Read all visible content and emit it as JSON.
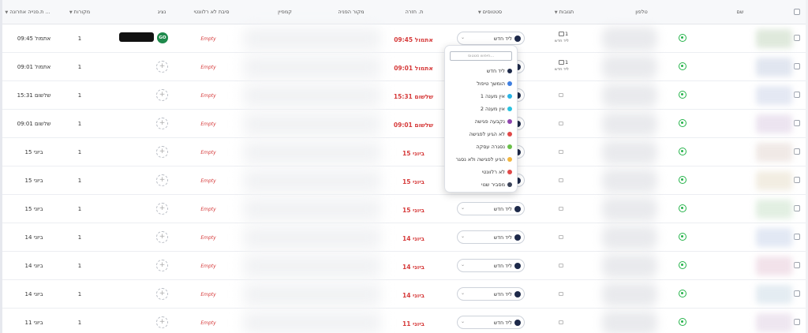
{
  "colors": {
    "accent_red": "#d63b3b",
    "whatsapp_green": "#25b34a",
    "status_new": "#1e2a4a"
  },
  "header": {
    "name": "שם",
    "phone": "טלפון",
    "messages": "תגובות",
    "status": "סטטוסים",
    "return_date": "ת. חזרה",
    "referrer": "מקור הפניה",
    "campaign": "קמפיין",
    "not_relevant_reason": "סיבת לא רלוונטי",
    "agent": "נציג",
    "sources": "מקורות",
    "last_created": "ת.פנייה אחרונה ..."
  },
  "rows": [
    {
      "msg_count": "1",
      "msg_sub": "ליד חדש",
      "status": "ליד חדש",
      "return_date": "אתמול 09:45",
      "reason": "Empty",
      "agent": "GO",
      "sources": "1",
      "created": "אתמול 09:45",
      "name_color": "#dfe9dc"
    },
    {
      "msg_count": "1",
      "msg_sub": "ליד חדש",
      "status": "ליד חדש",
      "return_date": "אתמול 09:01",
      "reason": "Empty",
      "agent": "",
      "sources": "1",
      "created": "אתמול 09:01",
      "name_color": "#e1e6f0"
    },
    {
      "msg_count": "",
      "msg_sub": "",
      "status": "ליד חדש",
      "return_date": "שלשום 15:31",
      "reason": "Empty",
      "agent": "",
      "sources": "1",
      "created": "שלשום 15:31",
      "name_color": "#e4e8f3"
    },
    {
      "msg_count": "",
      "msg_sub": "",
      "status": "ליד חדש",
      "return_date": "שלשום 09:01",
      "reason": "Empty",
      "agent": "",
      "sources": "1",
      "created": "שלשום 09:01",
      "name_color": "#ece4f0"
    },
    {
      "msg_count": "",
      "msg_sub": "",
      "status": "ליד חדש",
      "return_date": "15 ביוני",
      "reason": "Empty",
      "agent": "",
      "sources": "1",
      "created": "15 ביוני",
      "name_color": "#f0e9e6"
    },
    {
      "msg_count": "",
      "msg_sub": "",
      "status": "ליד חדש",
      "return_date": "15 ביוני",
      "reason": "Empty",
      "agent": "",
      "sources": "1",
      "created": "15 ביוני",
      "name_color": "#f2ede2"
    },
    {
      "msg_count": "",
      "msg_sub": "",
      "status": "ליד חדש",
      "return_date": "15 ביוני",
      "reason": "Empty",
      "agent": "",
      "sources": "1",
      "created": "15 ביוני",
      "name_color": "#e2efe2"
    },
    {
      "msg_count": "",
      "msg_sub": "",
      "status": "ליד חדש",
      "return_date": "14 ביוני",
      "reason": "Empty",
      "agent": "",
      "sources": "1",
      "created": "14 ביוני",
      "name_color": "#e2e8f4"
    },
    {
      "msg_count": "",
      "msg_sub": "",
      "status": "ליד חדש",
      "return_date": "14 ביוני",
      "reason": "Empty",
      "agent": "",
      "sources": "1",
      "created": "14 ביוני",
      "name_color": "#f2e2ea"
    },
    {
      "msg_count": "",
      "msg_sub": "",
      "status": "ליד חדש",
      "return_date": "14 ביוני",
      "reason": "Empty",
      "agent": "",
      "sources": "1",
      "created": "14 ביוני",
      "name_color": "#e4ecf2"
    },
    {
      "msg_count": "",
      "msg_sub": "",
      "status": "ליד חדש",
      "return_date": "11 ביוני",
      "reason": "Empty",
      "agent": "",
      "sources": "1",
      "created": "11 ביוני",
      "name_color": "#eee6f0"
    }
  ],
  "dropdown": {
    "search_placeholder": "חיפוש סטטוס...",
    "items": [
      {
        "label": "ליד חדש",
        "color": "#1e2a4a"
      },
      {
        "label": "הומשך טיפול",
        "color": "#3f7fe0"
      },
      {
        "label": "אין מענה 1",
        "color": "#28b4e6"
      },
      {
        "label": "אין מענה 2",
        "color": "#28c2e0"
      },
      {
        "label": "נקבעה פגישה",
        "color": "#8e44ad"
      },
      {
        "label": "לא הגיע לפגישה",
        "color": "#e04848"
      },
      {
        "label": "נסגרה עסקה",
        "color": "#6ac04a"
      },
      {
        "label": "הגיע לפגישה ולא נסגר",
        "color": "#f2b640"
      },
      {
        "label": "לא רלוונטי",
        "color": "#e04848"
      },
      {
        "label": "מסביר שנוי",
        "color": "#3a4258"
      }
    ]
  }
}
